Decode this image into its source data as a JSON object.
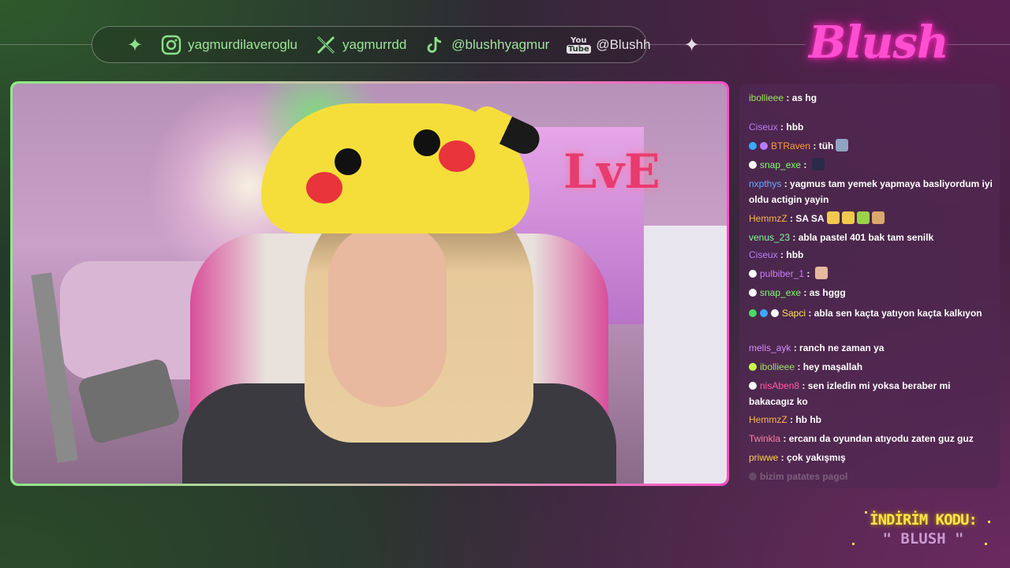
{
  "social": {
    "instagram": "yagmurdilaveroglu",
    "x": "yagmurrdd",
    "tiktok": "@blushhyagmur",
    "youtube": "@Blushh",
    "youtube_logo_top": "You",
    "youtube_logo_bottom": "Tube"
  },
  "logo": "Blush",
  "camera": {
    "sign_text": "LvE"
  },
  "chat": {
    "messages": [
      {
        "user": "ibollieee",
        "text": "as hg",
        "color": "#9ee36a",
        "partial": true
      },
      {
        "user": "Ciseux",
        "text": "hbb",
        "color": "#b97cff"
      },
      {
        "user": "BTRaven",
        "text": "tüh",
        "color": "#ff9a3c"
      },
      {
        "user": "snap_exe",
        "text": "",
        "color": "#7dff6a"
      },
      {
        "user": "nxpthys",
        "text": "yagmus tam yemek yapmaya basliyordum iyi oldu actigin yayin",
        "color": "#6ea8ff"
      },
      {
        "user": "HemmzZ",
        "text": "SA SA",
        "color": "#ffb347"
      },
      {
        "user": "venus_23",
        "text": "abla pastel 401 bak tam senilk",
        "color": "#7dff9a"
      },
      {
        "user": "Ciseux",
        "text": "hbb",
        "color": "#b97cff"
      },
      {
        "user": "pulbiber_1",
        "text": "",
        "color": "#c77dff"
      },
      {
        "user": "snap_exe",
        "text": "as hggg",
        "color": "#7dff6a"
      },
      {
        "user": "Sapci",
        "text": "abla sen kaçta yatıyon kaçta kalkıyon",
        "color": "#ffe34a"
      },
      {
        "user": "melis_ayk",
        "text": "ranch ne zaman ya",
        "color": "#d48bff"
      },
      {
        "user": "ibollieee",
        "text": "hey maşallah",
        "color": "#9ee36a"
      },
      {
        "user": "nisAben8",
        "text": "sen izledin mi yoksa beraber mi bakacagız ko",
        "color": "#ff5fa8"
      },
      {
        "user": "HemmzZ",
        "text": "hb hb",
        "color": "#ffb347"
      },
      {
        "user": "Twinkla",
        "text": "ercanı da oyundan atıyodu zaten guz guz",
        "color": "#ff7fa8"
      },
      {
        "user": "priwwe",
        "text": "çok yakışmış",
        "color": "#ffd24a"
      },
      {
        "user": "",
        "text": "bizim patates pagol",
        "color": "#cccccc",
        "faded": true
      }
    ]
  },
  "promo": {
    "line1": "İNDİRİM KODU:",
    "line2": "\" BLUSH \""
  },
  "colors": {
    "green_accent": "#8de08a",
    "pink_accent": "#ff4fd0",
    "chat_bg": "#50284f",
    "promo_yellow": "#ffe44a"
  }
}
